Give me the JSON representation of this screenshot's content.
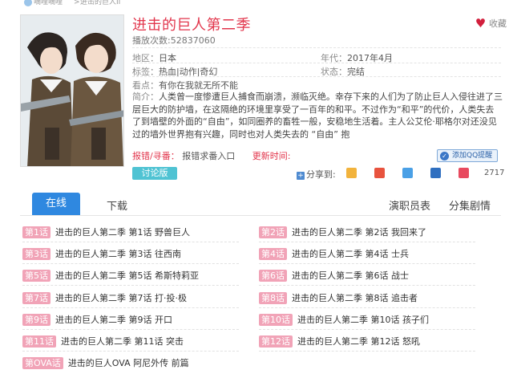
{
  "breadcrumb": {
    "site": "嘀哩嘀哩",
    "separator": ">",
    "current": "进击的巨人II"
  },
  "show": {
    "title": "进击的巨人第二季",
    "plays": "播放次数:52837060",
    "favorite": "收藏",
    "region_label": "地区：",
    "region": "日本",
    "year_label": "年代：",
    "year": "2017年4月",
    "tags_label": "标签：",
    "tags": "热血|动作|奇幻",
    "status_label": "状态：",
    "status": "完结",
    "watch_label": "看点：",
    "watch": "有你在我就无所不能",
    "intro_label": "简介：",
    "intro": "人类曾一度惨遭巨人捕食而崩溃，濒临灭绝。幸存下来的人们为了防止巨人入侵往进了三层巨大的防护墙，在这隔绝的环境里享受了一百年的和平。不过作为“和平”的代价，人类失去了到墙壁的外面的“自由”，如同圈养的畜牲一般，安稳地生活着。主人公艾伦·耶格尔对还没见过的墙外世界抱有兴趣，同时也对人类失去的 “自由” 抱",
    "report_label": "报错/寻番：",
    "report_text": "报错求番入口",
    "update_label": "更新时间:",
    "qq_label": "添加QQ提醒",
    "forum_label": "讨论版",
    "share_label": "分享到:",
    "share_count": "2717"
  },
  "tabs": {
    "online": "在线",
    "download": "下载",
    "cast": "演职员表",
    "plot": "分集剧情"
  },
  "episodes": [
    {
      "badge": "第1话",
      "title": "进击的巨人第二季 第1话 野兽巨人"
    },
    {
      "badge": "第2话",
      "title": "进击的巨人第二季 第2话 我回来了"
    },
    {
      "badge": "第3话",
      "title": "进击的巨人第二季 第3话 往西南"
    },
    {
      "badge": "第4话",
      "title": "进击的巨人第二季 第4话 士兵"
    },
    {
      "badge": "第5话",
      "title": "进击的巨人第二季 第5话 希斯特莉亚"
    },
    {
      "badge": "第6话",
      "title": "进击的巨人第二季 第6话 战士"
    },
    {
      "badge": "第7话",
      "title": "进击的巨人第二季 第7话 打·投·极"
    },
    {
      "badge": "第8话",
      "title": "进击的巨人第二季 第8话 追击者"
    },
    {
      "badge": "第9话",
      "title": "进击的巨人第二季 第9话 开口"
    },
    {
      "badge": "第10话",
      "title": "进击的巨人第二季 第10话 孩子们"
    },
    {
      "badge": "第11话",
      "title": "进击的巨人第二季 第11话 突击"
    },
    {
      "badge": "第12话",
      "title": "进击的巨人第二季 第12话 怒吼"
    },
    {
      "badge": "第OVA话",
      "title": "进击的巨人OVA 阿尼外传 前篇"
    }
  ],
  "colors": {
    "accent": "#e2364c",
    "tab": "#2f88e0",
    "badge": "#f1a3b7",
    "forum": "#4fc3d3"
  }
}
